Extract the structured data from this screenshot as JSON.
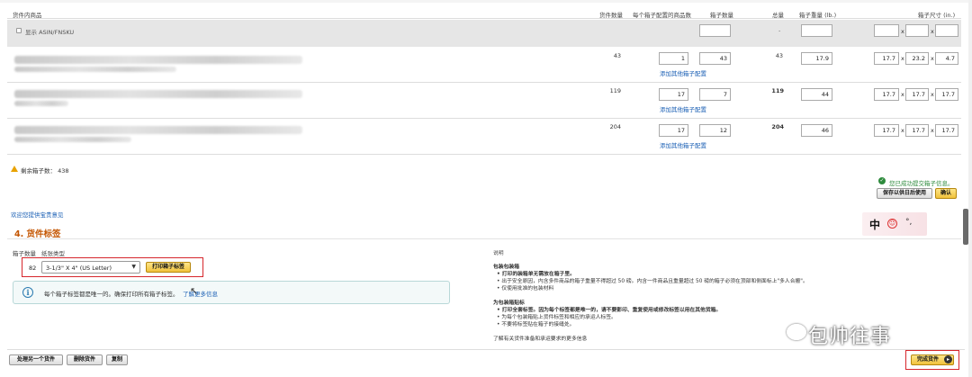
{
  "table": {
    "headers": {
      "content": "货件内商品",
      "units": "货件数量",
      "units_per_box": "每个箱子配置的商品数",
      "boxes": "箱子数量",
      "total": "总量",
      "box_weight": "箱子重量 (lb.)",
      "box_dims": "箱子尺寸 (in.)"
    },
    "asin_label": "显示 ASIN/FNSKU",
    "asin_total": "-",
    "add_config_link": "添加其他箱子配置",
    "rows": [
      {
        "units": "43",
        "per_box": "1",
        "boxes": "43",
        "total": "43",
        "weight": "17.9",
        "l": "17.7",
        "w": "23.2",
        "h": "4.7"
      },
      {
        "units": "119",
        "per_box": "17",
        "boxes": "7",
        "total": "119",
        "weight": "44",
        "l": "17.7",
        "w": "17.7",
        "h": "17.7"
      },
      {
        "units": "204",
        "per_box": "17",
        "boxes": "12",
        "total": "204",
        "weight": "46",
        "l": "17.7",
        "w": "17.7",
        "h": "17.7"
      }
    ],
    "x_sep": "x"
  },
  "summary": {
    "remaining_boxes": "剩余箱子数： 438",
    "success_msg": "您已成功提交箱子信息。",
    "save_later": "保存以供日后使用",
    "confirm": "确认",
    "feedback_link": "欢迎您提供宝贵意见"
  },
  "labels": {
    "section_title": "4. 货件标签",
    "col_box_count": "箱子数量",
    "col_paper_type": "纸张类型",
    "box_count": "82",
    "paper_type": "3-1/3\" X 4\" (US Letter)",
    "print_button": "打印箱子标签",
    "info_text": "每个箱子标签都是唯一的。确保打印所有箱子标签。",
    "info_link": "了解更多信息"
  },
  "instructions": {
    "heading": "说明",
    "pack_title": "包装包装箱",
    "pack_items": [
      "打印的装箱单无需放在箱子里。",
      "出于安全原因，内含多件商品的箱子重量不得超过 50 磅。内含一件商品且重量超过 50 磅的箱子必须在顶部和侧面标上\"多人合搬\"。",
      "仅使用批准的包装材料"
    ],
    "label_title": "为包装箱贴标",
    "label_items": [
      "打印全套标签。因为每个标签都是唯一的，请不要影印、重复使用或修改标签以用在其他货箱。",
      "为每个包装箱贴上货件标签和相应的承运人标签。",
      "不要将标签贴在箱子的接缝处。"
    ],
    "more_link": "了解有关货件准备和承运要求的更多信息"
  },
  "ime": {
    "lang": "中"
  },
  "footer": {
    "handle_another": "处理另一个货件",
    "delete_shipment": "删除货件",
    "copy": "复制",
    "complete": "完成货件"
  },
  "watermark": "包帅往事",
  "colors": {
    "accent": "#c45500",
    "link": "#1a5fb4",
    "highlight": "#d6262c",
    "button_yellow": "#f1c23b"
  }
}
